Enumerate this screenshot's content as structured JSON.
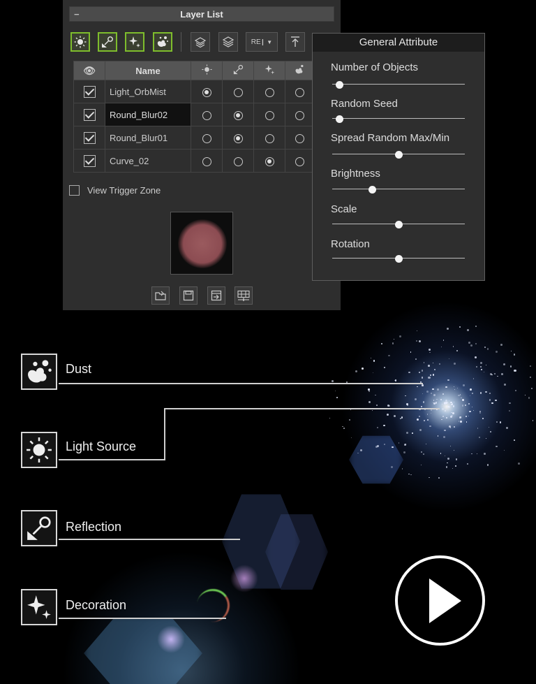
{
  "panel": {
    "title": "Layer List",
    "collapse_symbol": "−",
    "toolbar": {
      "buttons": [
        {
          "name": "light-source-filter-button",
          "icon": "light-source-icon",
          "active": true
        },
        {
          "name": "reflection-filter-button",
          "icon": "reflection-icon",
          "active": true
        },
        {
          "name": "decoration-filter-button",
          "icon": "decoration-icon",
          "active": true
        },
        {
          "name": "dust-filter-button",
          "icon": "dust-icon",
          "active": true
        },
        {
          "name": "add-layer-button",
          "icon": "layer-add-icon",
          "active": false
        },
        {
          "name": "layers-stack-button",
          "icon": "layers-icon",
          "active": false
        },
        {
          "name": "rename-button",
          "icon": "rename-icon",
          "active": false
        },
        {
          "name": "move-top-button",
          "icon": "move-top-icon",
          "active": false
        }
      ],
      "rename_text": "RE"
    },
    "table": {
      "header_name": "Name",
      "rows": [
        {
          "name": "Light_OrbMist",
          "visible": true,
          "type": 0,
          "selected": false
        },
        {
          "name": "Round_Blur02",
          "visible": true,
          "type": 1,
          "selected": true
        },
        {
          "name": "Round_Blur01",
          "visible": true,
          "type": 1,
          "selected": false
        },
        {
          "name": "Curve_02",
          "visible": true,
          "type": 2,
          "selected": false
        }
      ]
    },
    "view_trigger_zone_label": "View Trigger Zone",
    "bottom_buttons": [
      "load-icon",
      "save-icon",
      "export-icon",
      "grid-settings-icon"
    ]
  },
  "general_attribute": {
    "title": "General Attribute",
    "sliders": [
      {
        "label": "Number of Objects",
        "value": 0.05
      },
      {
        "label": "Random Seed",
        "value": 0.05
      },
      {
        "label": "Spread Random Max/Min",
        "value": 0.5
      },
      {
        "label": "Brightness",
        "value": 0.3
      },
      {
        "label": "Scale",
        "value": 0.5
      },
      {
        "label": "Rotation",
        "value": 0.5
      }
    ]
  },
  "legend": {
    "dust": "Dust",
    "light_source": "Light Source",
    "reflection": "Reflection",
    "decoration": "Decoration"
  },
  "colors": {
    "active_green": "#7ebd2c",
    "panel_bg": "#2e2e2e"
  }
}
